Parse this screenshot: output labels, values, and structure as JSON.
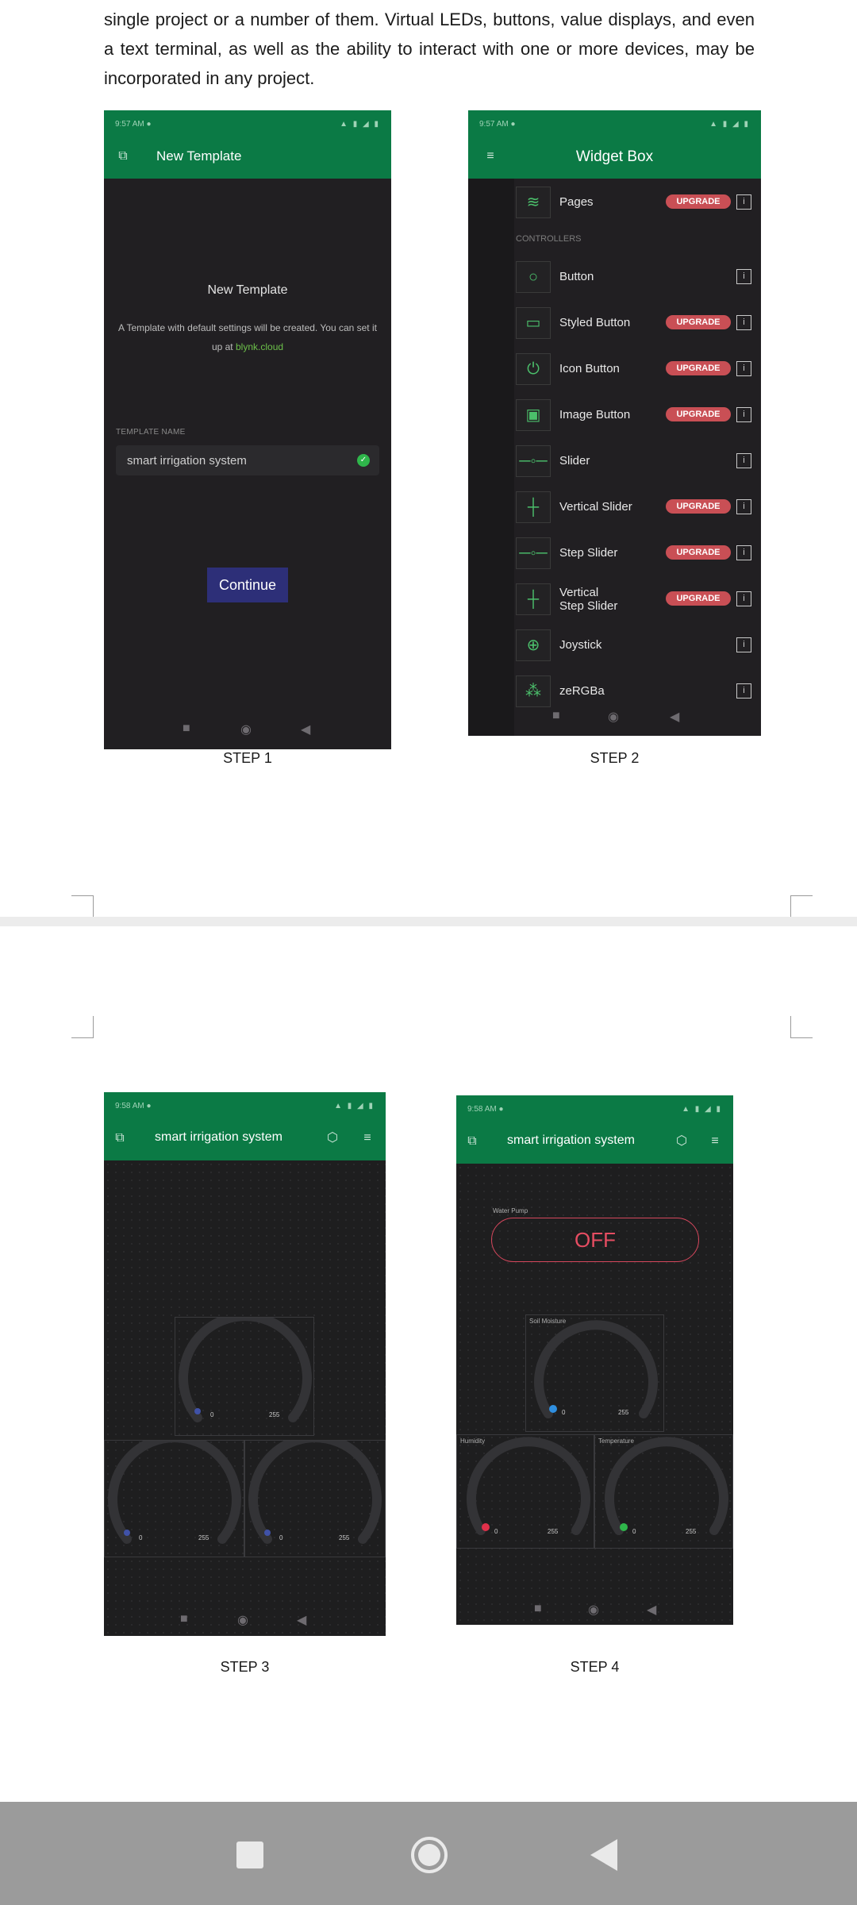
{
  "document": {
    "paragraph": "single project or a number of them. Virtual LEDs, buttons, value displays, and even a text terminal, as well as the ability to interact with one or more devices, may be incorporated in any project."
  },
  "step1": {
    "caption": "STEP 1",
    "app_title": "New Template",
    "heading": "New Template",
    "description": "A Template with default settings will be created. You can set it up at",
    "link": "blynk.cloud",
    "field_label": "TEMPLATE NAME",
    "field_value": "smart irrigation system",
    "button": "Continue"
  },
  "step2": {
    "caption": "STEP 2",
    "app_title": "Widget Box",
    "section_label": "CONTROLLERS",
    "upgrade_label": "UPGRADE",
    "info_label": "i",
    "widgets": [
      {
        "name": "Pages",
        "upgrade": true,
        "icon": "layers-icon",
        "glyph": "≋"
      },
      {
        "name": "Button",
        "upgrade": false,
        "icon": "circle-icon",
        "glyph": "○"
      },
      {
        "name": "Styled Button",
        "upgrade": true,
        "icon": "styled-button-icon",
        "glyph": "▭"
      },
      {
        "name": "Icon Button",
        "upgrade": true,
        "icon": "power-icon",
        "glyph": "⏻"
      },
      {
        "name": "Image Button",
        "upgrade": true,
        "icon": "image-icon",
        "glyph": "▣"
      },
      {
        "name": "Slider",
        "upgrade": false,
        "icon": "slider-icon",
        "glyph": "─◦─"
      },
      {
        "name": "Vertical Slider",
        "upgrade": true,
        "icon": "vertical-slider-icon",
        "glyph": "┼"
      },
      {
        "name": "Step Slider",
        "upgrade": true,
        "icon": "step-slider-icon",
        "glyph": "─◦─"
      },
      {
        "name": "Vertical\nStep Slider",
        "upgrade": true,
        "icon": "vertical-step-slider-icon",
        "glyph": "┼"
      },
      {
        "name": "Joystick",
        "upgrade": false,
        "icon": "joystick-icon",
        "glyph": "⊕"
      },
      {
        "name": "zeRGBa",
        "upgrade": false,
        "icon": "zergba-icon",
        "glyph": "⁂"
      }
    ]
  },
  "step3": {
    "caption": "STEP 3",
    "app_title": "smart irrigation system",
    "gauge_min": "0",
    "gauge_max": "255"
  },
  "step4": {
    "caption": "STEP 4",
    "app_title": "smart irrigation system",
    "pump_label": "Water Pump",
    "pump_state": "OFF",
    "gauges": [
      {
        "label": "Soil Moisture",
        "min": "0",
        "max": "255",
        "color": "#2f8fe0"
      },
      {
        "label": "Humidity",
        "min": "0",
        "max": "255",
        "color": "#e0304a"
      },
      {
        "label": "Temperature",
        "min": "0",
        "max": "255",
        "color": "#2fb64b"
      }
    ]
  },
  "colors": {
    "app_bar": "#0b7a45",
    "upgrade_badge": "#c94f55",
    "accent_link": "#6cc04a",
    "continue_button": "#2d2f78"
  }
}
